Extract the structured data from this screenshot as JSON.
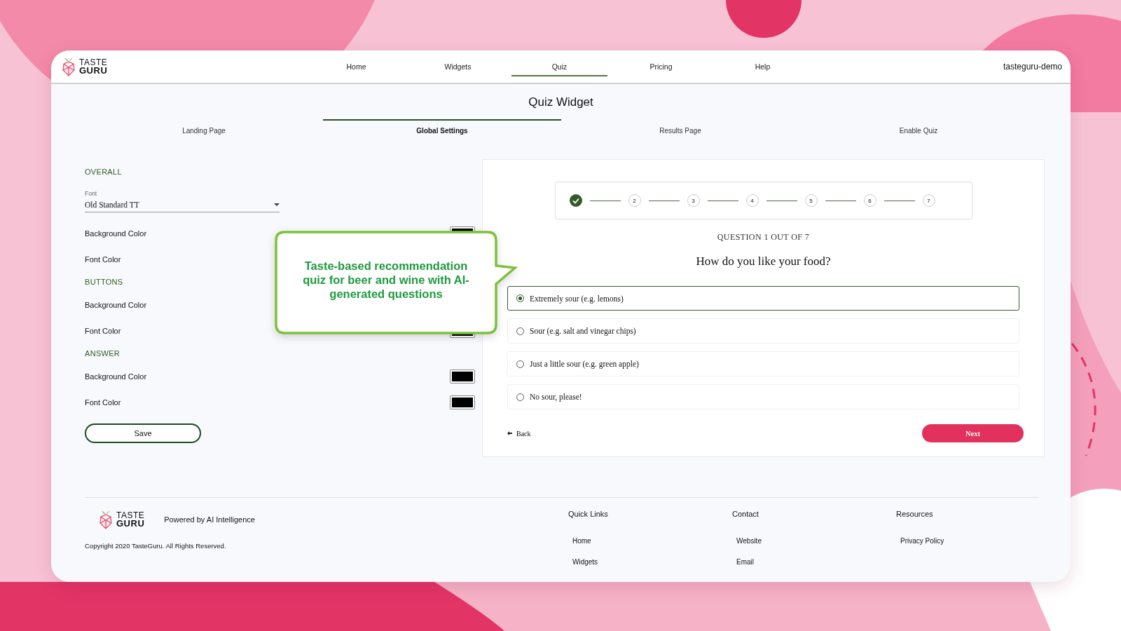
{
  "header": {
    "logo": {
      "line_1": "TASTE",
      "line_2": "GURU"
    },
    "nav": [
      {
        "label": "Home",
        "selected": false
      },
      {
        "label": "Widgets",
        "selected": false
      },
      {
        "label": "Quiz",
        "selected": true
      },
      {
        "label": "Pricing",
        "selected": false
      },
      {
        "label": "Help",
        "selected": false
      }
    ],
    "account": "tasteguru-demo"
  },
  "page_title": "Quiz Widget",
  "tabs": [
    {
      "label": "Landing Page",
      "selected": false
    },
    {
      "label": "Global Settings",
      "selected": true
    },
    {
      "label": "Results Page",
      "selected": false
    },
    {
      "label": "Enable Quiz",
      "selected": false
    }
  ],
  "settings": {
    "sections": [
      {
        "heading": "OVERALL",
        "font_field": {
          "label": "Font",
          "value": "Old Standard TT"
        },
        "rows": [
          {
            "label": "Background Color",
            "kind": "swatch"
          },
          {
            "label": "Font Color",
            "kind": "plain"
          }
        ]
      },
      {
        "heading": "BUTTONS",
        "rows": [
          {
            "label": "Background Color",
            "kind": "plain"
          },
          {
            "label": "Font Color",
            "kind": "swatch"
          }
        ]
      },
      {
        "heading": "ANSWER",
        "rows": [
          {
            "label": "Background Color",
            "kind": "swatch"
          },
          {
            "label": "Font Color",
            "kind": "swatch"
          }
        ]
      }
    ],
    "save_button": "Save"
  },
  "preview": {
    "steps": [
      {
        "done": true
      },
      {
        "label": "2",
        "done": false
      },
      {
        "label": "3",
        "done": false
      },
      {
        "label": "4",
        "done": false
      },
      {
        "label": "5",
        "done": false
      },
      {
        "label": "6",
        "done": false
      },
      {
        "label": "7",
        "done": false
      }
    ],
    "question_counter": "QUESTION 1 OUT OF 7",
    "question": "How do you like your food?",
    "options": [
      {
        "label": "Extremely sour (e.g. lemons)",
        "selected": true
      },
      {
        "label": "Sour (e.g. salt and vinegar chips)",
        "selected": false
      },
      {
        "label": "Just a little sour (e.g. green apple)",
        "selected": false
      },
      {
        "label": "No sour, please!",
        "selected": false
      }
    ],
    "back_button": "Back",
    "next_button": "Next"
  },
  "callout": "Taste-based recommendation quiz for beer and wine with AI-generated questions",
  "footer": {
    "logo": {
      "line_1": "TASTE",
      "line_2": "GURU"
    },
    "tagline": "Powered by AI Intelligence",
    "copyright": "Copyright 2020 TasteGuru. All Rights Reserved.",
    "columns": [
      {
        "heading": "Quick Links",
        "links": [
          "Home",
          "Widgets"
        ]
      },
      {
        "heading": "Contact",
        "links": [
          "Website",
          "Email"
        ]
      },
      {
        "heading": "Resources",
        "links": [
          "Privacy Policy"
        ]
      }
    ]
  }
}
